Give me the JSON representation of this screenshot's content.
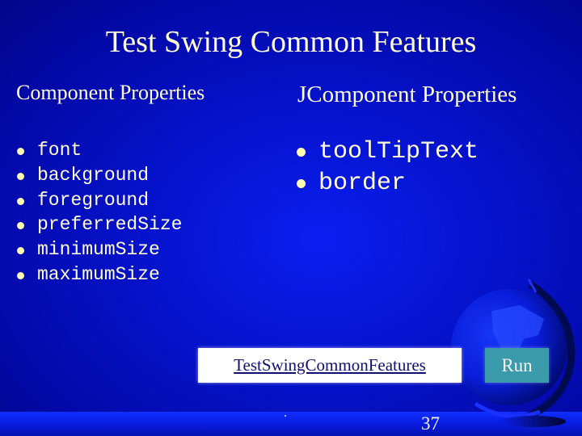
{
  "slide": {
    "title": "Test Swing Common Features",
    "page_number": "37",
    "background_color": "#0614d0",
    "text_color": "#fffdd8"
  },
  "left_column": {
    "heading": "Component Properties",
    "items": [
      "font",
      "background",
      "foreground",
      "preferredSize",
      "minimumSize",
      "maximumSize"
    ]
  },
  "right_column": {
    "heading": "JComponent Properties",
    "items": [
      "toolTipText",
      "border"
    ]
  },
  "actions": {
    "link_label": "TestSwingCommonFeatures",
    "run_label": "Run",
    "run_color": "#3b9aac"
  },
  "decoration": {
    "icon": "globe-icon"
  }
}
